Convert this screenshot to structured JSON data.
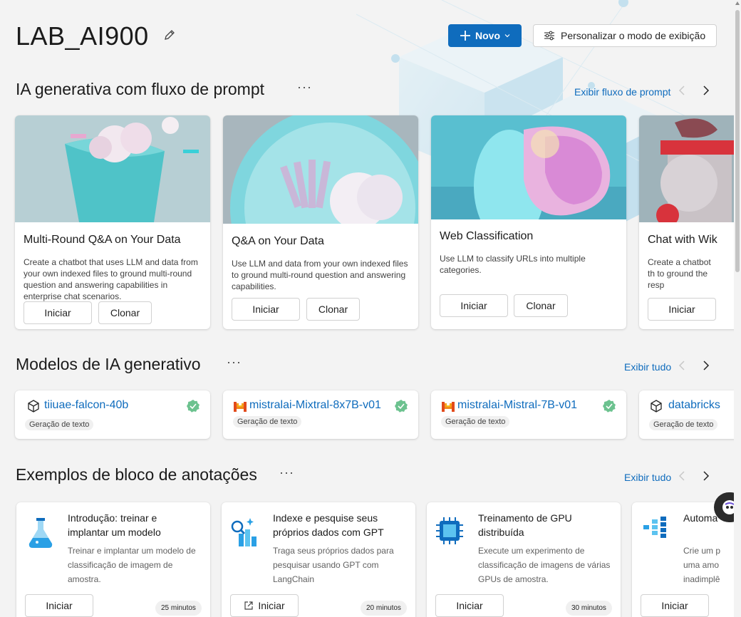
{
  "header": {
    "title": "LAB_AI900",
    "new_button": "Novo",
    "customize_button": "Personalizar o modo de exibição"
  },
  "prompt_flow": {
    "title": "IA generativa com fluxo de prompt",
    "more": "···",
    "link": "Exibir fluxo de prompt",
    "cards": [
      {
        "title": "Multi-Round Q&A on Your Data",
        "desc": "Create a chatbot that uses LLM and data from your own indexed files to ground multi-round question and answering capabilities in enterprise chat scenarios.",
        "start": "Iniciar",
        "clone": "Clonar"
      },
      {
        "title": "Q&A on Your Data",
        "desc": "Use LLM and data from your own indexed files to ground multi-round question and answering capabilities.",
        "start": "Iniciar",
        "clone": "Clonar"
      },
      {
        "title": "Web Classification",
        "desc": "Use LLM to classify URLs into multiple categories.",
        "start": "Iniciar",
        "clone": "Clonar"
      },
      {
        "title": "Chat with Wik",
        "desc": "Create a chatbot th to ground the resp",
        "start": "Iniciar"
      }
    ]
  },
  "models": {
    "title": "Modelos de IA generativo",
    "more": "···",
    "link": "Exibir tudo",
    "cards": [
      {
        "name": "tiiuae-falcon-40b",
        "tag": "Geração de texto"
      },
      {
        "name": "mistralai-Mixtral-8x7B-v01",
        "tag": "Geração de texto"
      },
      {
        "name": "mistralai-Mistral-7B-v01",
        "tag": "Geração de texto"
      },
      {
        "name": "databricks",
        "tag": "Geração de texto"
      }
    ]
  },
  "notebooks": {
    "title": "Exemplos de bloco de anotações",
    "more": "···",
    "link": "Exibir tudo",
    "cards": [
      {
        "title": "Introdução: treinar e implantar um modelo",
        "desc": "Treinar e implantar um modelo de classificação de imagem de amostra.",
        "start": "Iniciar",
        "time": "25 minutos"
      },
      {
        "title": "Indexe e pesquise seus próprios dados com GPT",
        "desc": "Traga seus próprios dados para pesquisar usando GPT com LangChain",
        "start": "Iniciar",
        "time": "20 minutos"
      },
      {
        "title": "Treinamento de GPU distribuída",
        "desc": "Execute um experimento de classificação de imagens de várias GPUs de amostra.",
        "start": "Iniciar",
        "time": "30 minutos"
      },
      {
        "title": "Automa",
        "desc": "Crie um p uma amo inadimplê",
        "start": "Iniciar"
      }
    ]
  },
  "colors": {
    "accent": "#0f6cbd",
    "success": "#6cc28f"
  }
}
